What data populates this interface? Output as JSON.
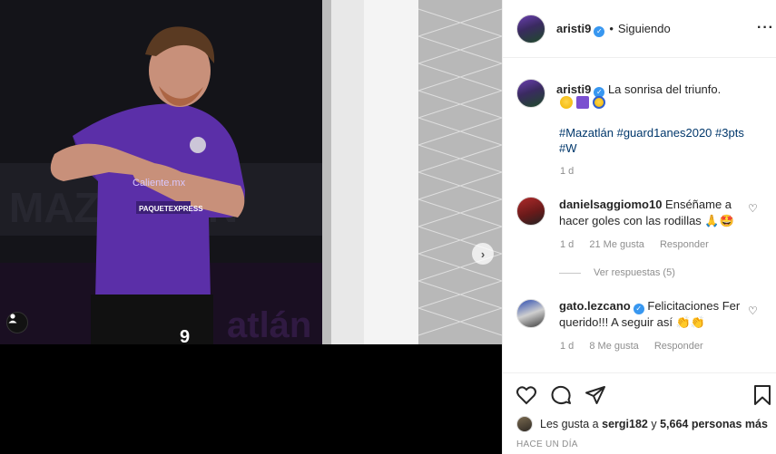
{
  "post": {
    "author": "aristi9",
    "follow_separator": "•",
    "follow_status": "Siguiendo",
    "more_label": "···",
    "caption_text": "La sonrisa del triunfo.",
    "caption_emojis": [
      "grinning-face-emoji",
      "purple-square-emoji",
      "ball-emoji"
    ],
    "hashtags": "#Mazatlán #guard1anes2020 #3pts #W",
    "caption_time": "1 d",
    "photo_jersey_number": "9",
    "photo_sponsor_line": "PAQUETEXPRESS",
    "photo_sponsor_top": "Caliente.mx"
  },
  "comments": [
    {
      "author": "danielsaggiomo10",
      "verified": false,
      "text": "Enséñame a hacer goles con las rodillas 🙏🤩",
      "time": "1 d",
      "likes": "21 Me gusta",
      "reply_label": "Responder",
      "view_replies": "Ver respuestas (5)"
    },
    {
      "author": "gato.lezcano",
      "verified": true,
      "text": "Felicitaciones Fer querido!!! A seguir así 👏👏",
      "time": "1 d",
      "likes": "8 Me gusta",
      "reply_label": "Responder"
    }
  ],
  "footer": {
    "likes_prefix": "Les gusta a",
    "likes_user": "sergi182",
    "likes_middle": "y",
    "likes_count": "5,664 personas más",
    "posted_ago": "HACE UN DÍA"
  },
  "colors": {
    "accent_blue": "#3897f0",
    "hashtag_blue": "#00376b",
    "muted_gray": "#8e8e8e",
    "jersey_purple": "#5b2fa8"
  }
}
